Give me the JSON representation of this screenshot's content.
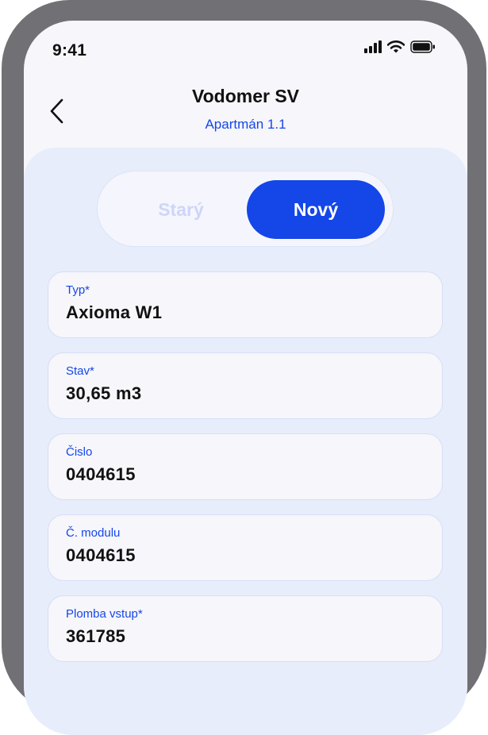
{
  "status_bar": {
    "time": "9:41",
    "icons": [
      "signal-icon",
      "wifi-icon",
      "battery-icon"
    ]
  },
  "header": {
    "back_icon": "chevron-left-icon",
    "title": "Vodomer SV",
    "subtitle": "Apartmán 1.1"
  },
  "toggle": {
    "options": [
      "Starý",
      "Nový"
    ],
    "selected": "Nový"
  },
  "fields": [
    {
      "label": "Typ*",
      "value": "Axioma W1"
    },
    {
      "label": "Stav*",
      "value": "30,65 m3"
    },
    {
      "label": "Čislo",
      "value": "0404615"
    },
    {
      "label": "Č. modulu",
      "value": "0404615"
    },
    {
      "label": "Plomba vstup*",
      "value": "361785"
    }
  ],
  "colors": {
    "accent": "#1446E8",
    "panel_background": "#E8EDFB",
    "screen_background": "#F6F6FB",
    "frame": "#717175",
    "inactive_toggle_text": "#CDD6F7"
  }
}
